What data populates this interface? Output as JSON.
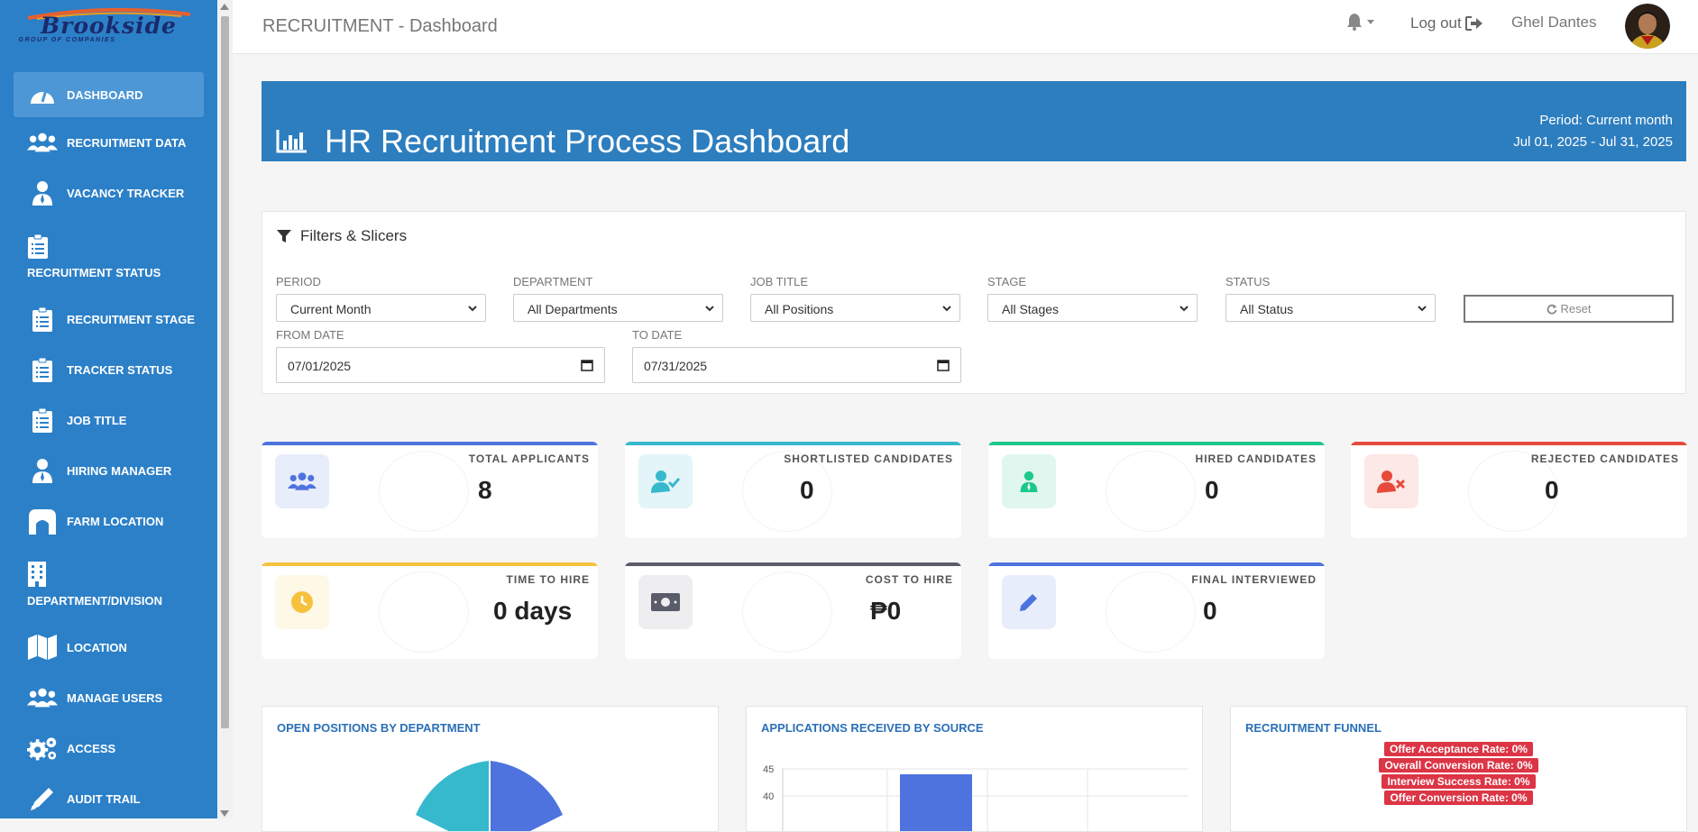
{
  "logo": {
    "line1": "Brookside",
    "line2": "GROUP OF COMPANIES"
  },
  "sidebar": {
    "items": [
      {
        "label": "DASHBOARD",
        "icon": "dashboard-icon",
        "active": true
      },
      {
        "label": "RECRUITMENT DATA",
        "icon": "users-icon"
      },
      {
        "label": "VACANCY TRACKER",
        "icon": "user-tie-icon"
      },
      {
        "label": "RECRUITMENT STATUS",
        "icon": "clipboard-list-icon"
      },
      {
        "label": "RECRUITMENT STAGE",
        "icon": "clipboard-list-icon"
      },
      {
        "label": "TRACKER STATUS",
        "icon": "clipboard-list-icon"
      },
      {
        "label": "JOB TITLE",
        "icon": "clipboard-list-icon"
      },
      {
        "label": "HIRING MANAGER",
        "icon": "user-tie-icon"
      },
      {
        "label": "FARM LOCATION",
        "icon": "warehouse-icon"
      },
      {
        "label": "DEPARTMENT/DIVISION",
        "icon": "building-icon"
      },
      {
        "label": "LOCATION",
        "icon": "map-icon"
      },
      {
        "label": "MANAGE USERS",
        "icon": "users-icon"
      },
      {
        "label": "ACCESS",
        "icon": "cogs-icon"
      },
      {
        "label": "AUDIT TRAIL",
        "icon": "pencil-icon"
      }
    ]
  },
  "header": {
    "title": "RECRUITMENT - Dashboard",
    "logout": "Log out",
    "username": "Ghel Dantes"
  },
  "hero": {
    "title": "HR Recruitment Process Dashboard",
    "period_label": "Period: Current month",
    "period_range": "Jul 01, 2025 - Jul 31, 2025"
  },
  "filters": {
    "title": "Filters & Slicers",
    "period": {
      "label": "PERIOD",
      "value": "Current Month"
    },
    "department": {
      "label": "DEPARTMENT",
      "value": "All Departments"
    },
    "job_title": {
      "label": "JOB TITLE",
      "value": "All Positions"
    },
    "stage": {
      "label": "STAGE",
      "value": "All Stages"
    },
    "status": {
      "label": "STATUS",
      "value": "All Status"
    },
    "reset": "Reset",
    "from_date": {
      "label": "FROM DATE",
      "value": "07/01/2025"
    },
    "to_date": {
      "label": "TO DATE",
      "value": "07/31/2025"
    }
  },
  "cards": [
    {
      "label": "TOTAL APPLICANTS",
      "value": "8",
      "color": "#4e73df",
      "icon": "users-icon"
    },
    {
      "label": "SHORTLISTED CANDIDATES",
      "value": "0",
      "color": "#36b9cc",
      "icon": "user-check-icon"
    },
    {
      "label": "HIRED CANDIDATES",
      "value": "0",
      "color": "#1cc88a",
      "icon": "user-tie-icon"
    },
    {
      "label": "REJECTED CANDIDATES",
      "value": "0",
      "color": "#e74a3b",
      "icon": "user-times-icon"
    },
    {
      "label": "TIME TO HIRE",
      "value": "0 days",
      "color": "#f6c23e",
      "icon": "clock-icon"
    },
    {
      "label": "COST TO HIRE",
      "value": "₱0",
      "color": "#5a5c69",
      "icon": "money-bill-icon"
    },
    {
      "label": "FINAL INTERVIEWED",
      "value": "0",
      "color": "#4e73df",
      "icon": "pen-icon"
    }
  ],
  "panels": {
    "open_positions": {
      "title": "OPEN POSITIONS BY DEPARTMENT"
    },
    "applications": {
      "title": "APPLICATIONS RECEIVED BY SOURCE",
      "y_ticks": [
        "45",
        "40"
      ]
    },
    "funnel": {
      "title": "RECRUITMENT FUNNEL",
      "badges": [
        "Offer Acceptance Rate: 0%",
        "Overall Conversion Rate: 0%",
        "Interview Success Rate: 0%",
        "Offer Conversion Rate: 0%"
      ]
    }
  },
  "colors": {
    "sidebar": "#2c80c8",
    "hero": "#2d7ebf",
    "badge": "#dc3545",
    "chart_blue": "#4e73df",
    "chart_teal": "#36b9cc"
  }
}
